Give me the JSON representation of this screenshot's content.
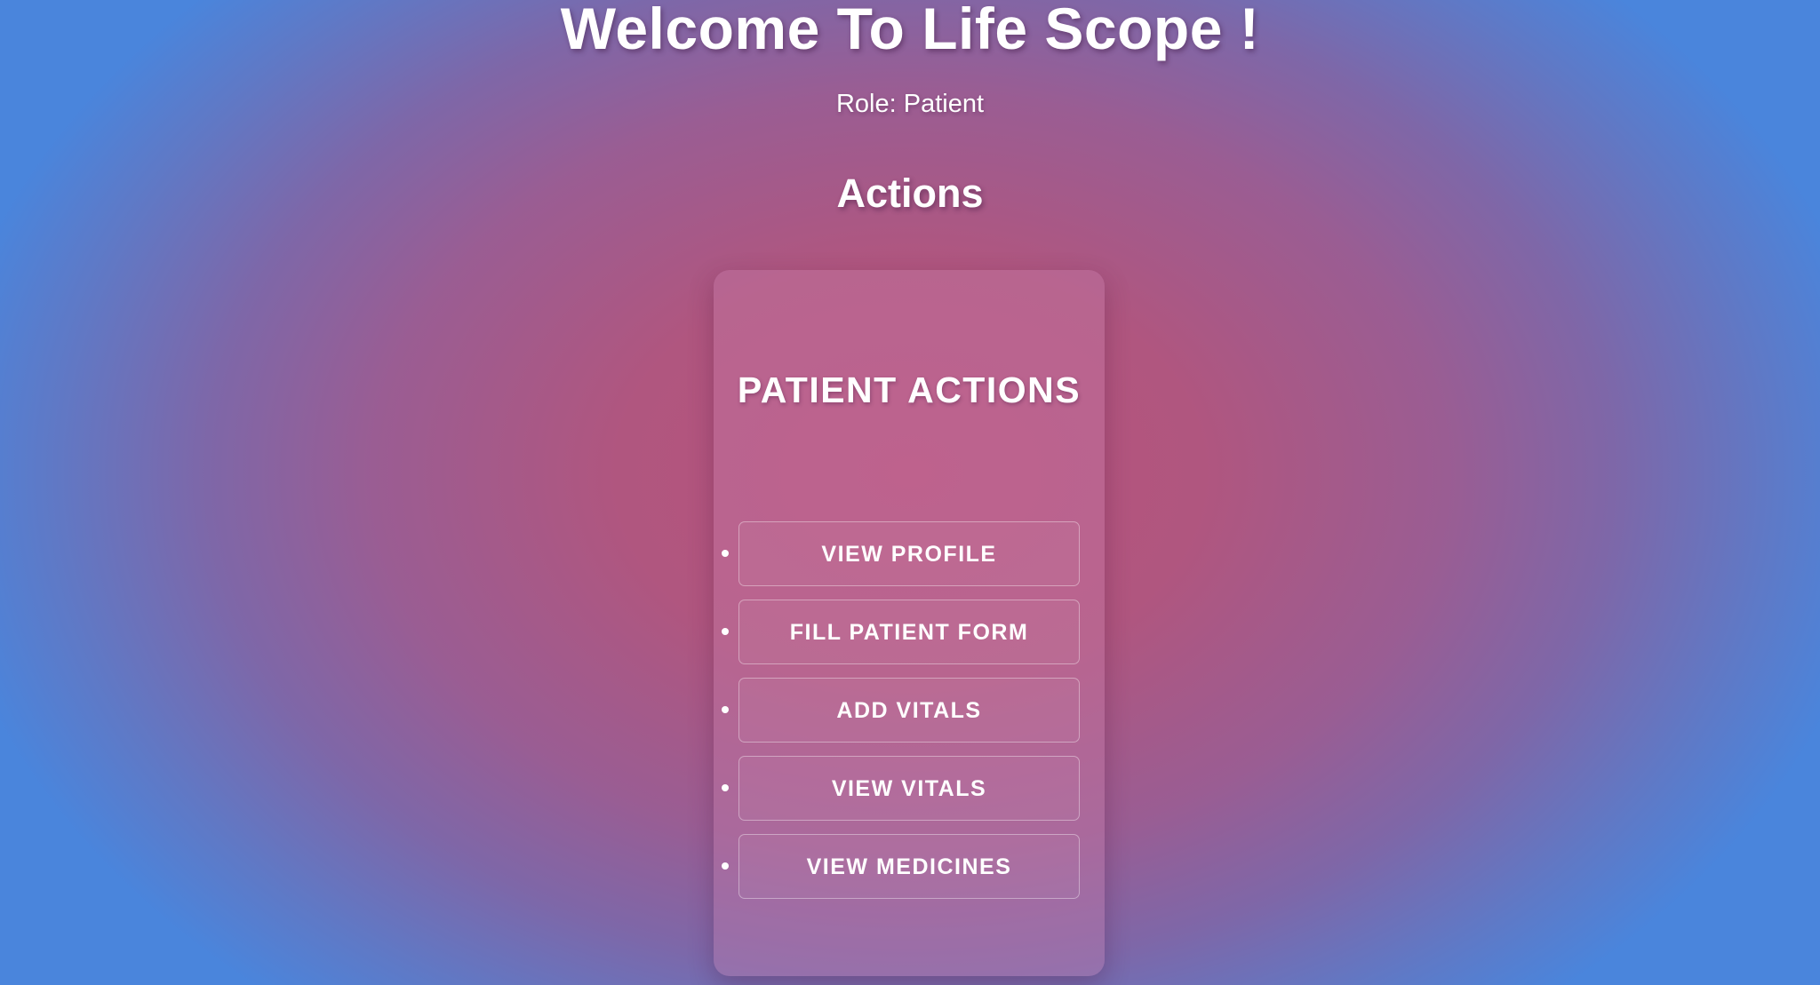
{
  "header": {
    "title": "Welcome To Life Scope !",
    "role": "Role: Patient",
    "section_heading": "Actions"
  },
  "card": {
    "title": "PATIENT ACTIONS",
    "actions": [
      {
        "label": "VIEW PROFILE"
      },
      {
        "label": "FILL PATIENT FORM"
      },
      {
        "label": "ADD VITALS"
      },
      {
        "label": "VIEW VITALS"
      },
      {
        "label": "VIEW MEDICINES"
      }
    ]
  },
  "colors": {
    "background_center": "#b8527c",
    "background_edge": "#4a85dc",
    "text": "#ffffff"
  }
}
